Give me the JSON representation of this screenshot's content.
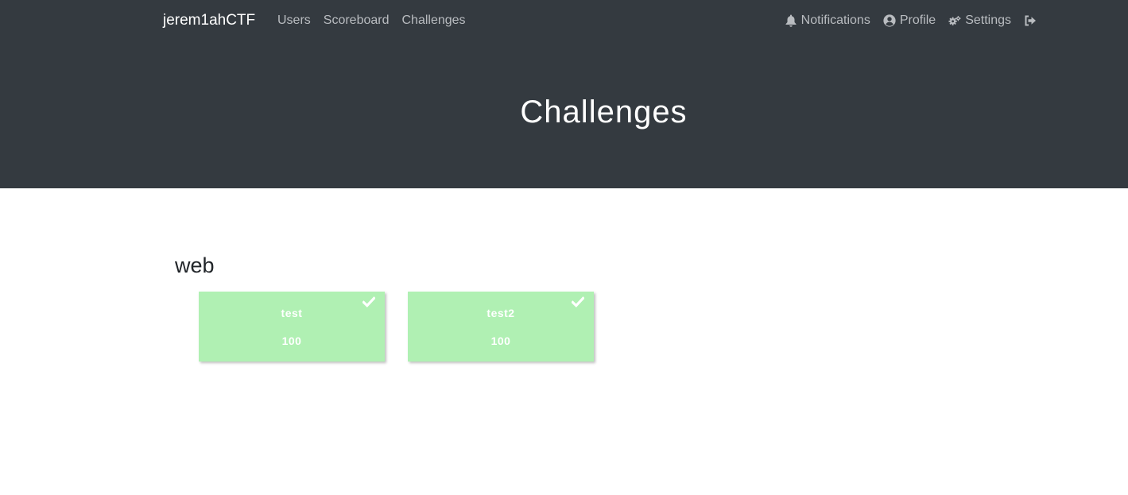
{
  "navbar": {
    "brand": "jerem1ahCTF",
    "left_links": [
      {
        "label": "Users"
      },
      {
        "label": "Scoreboard"
      },
      {
        "label": "Challenges"
      }
    ],
    "right_links": [
      {
        "label": "Notifications",
        "icon": "bell-icon"
      },
      {
        "label": "Profile",
        "icon": "user-circle-icon"
      },
      {
        "label": "Settings",
        "icon": "gears-icon"
      },
      {
        "label": "",
        "icon": "sign-out-icon"
      }
    ]
  },
  "page": {
    "title": "Challenges"
  },
  "categories": [
    {
      "name": "web",
      "challenges": [
        {
          "name": "test",
          "value": "100",
          "solved": true
        },
        {
          "name": "test2",
          "value": "100",
          "solved": true
        }
      ]
    }
  ],
  "colors": {
    "header_bg": "#343a40",
    "solved_card_bg": "#b0f0b3",
    "nav_link": "#b9bcc0"
  }
}
